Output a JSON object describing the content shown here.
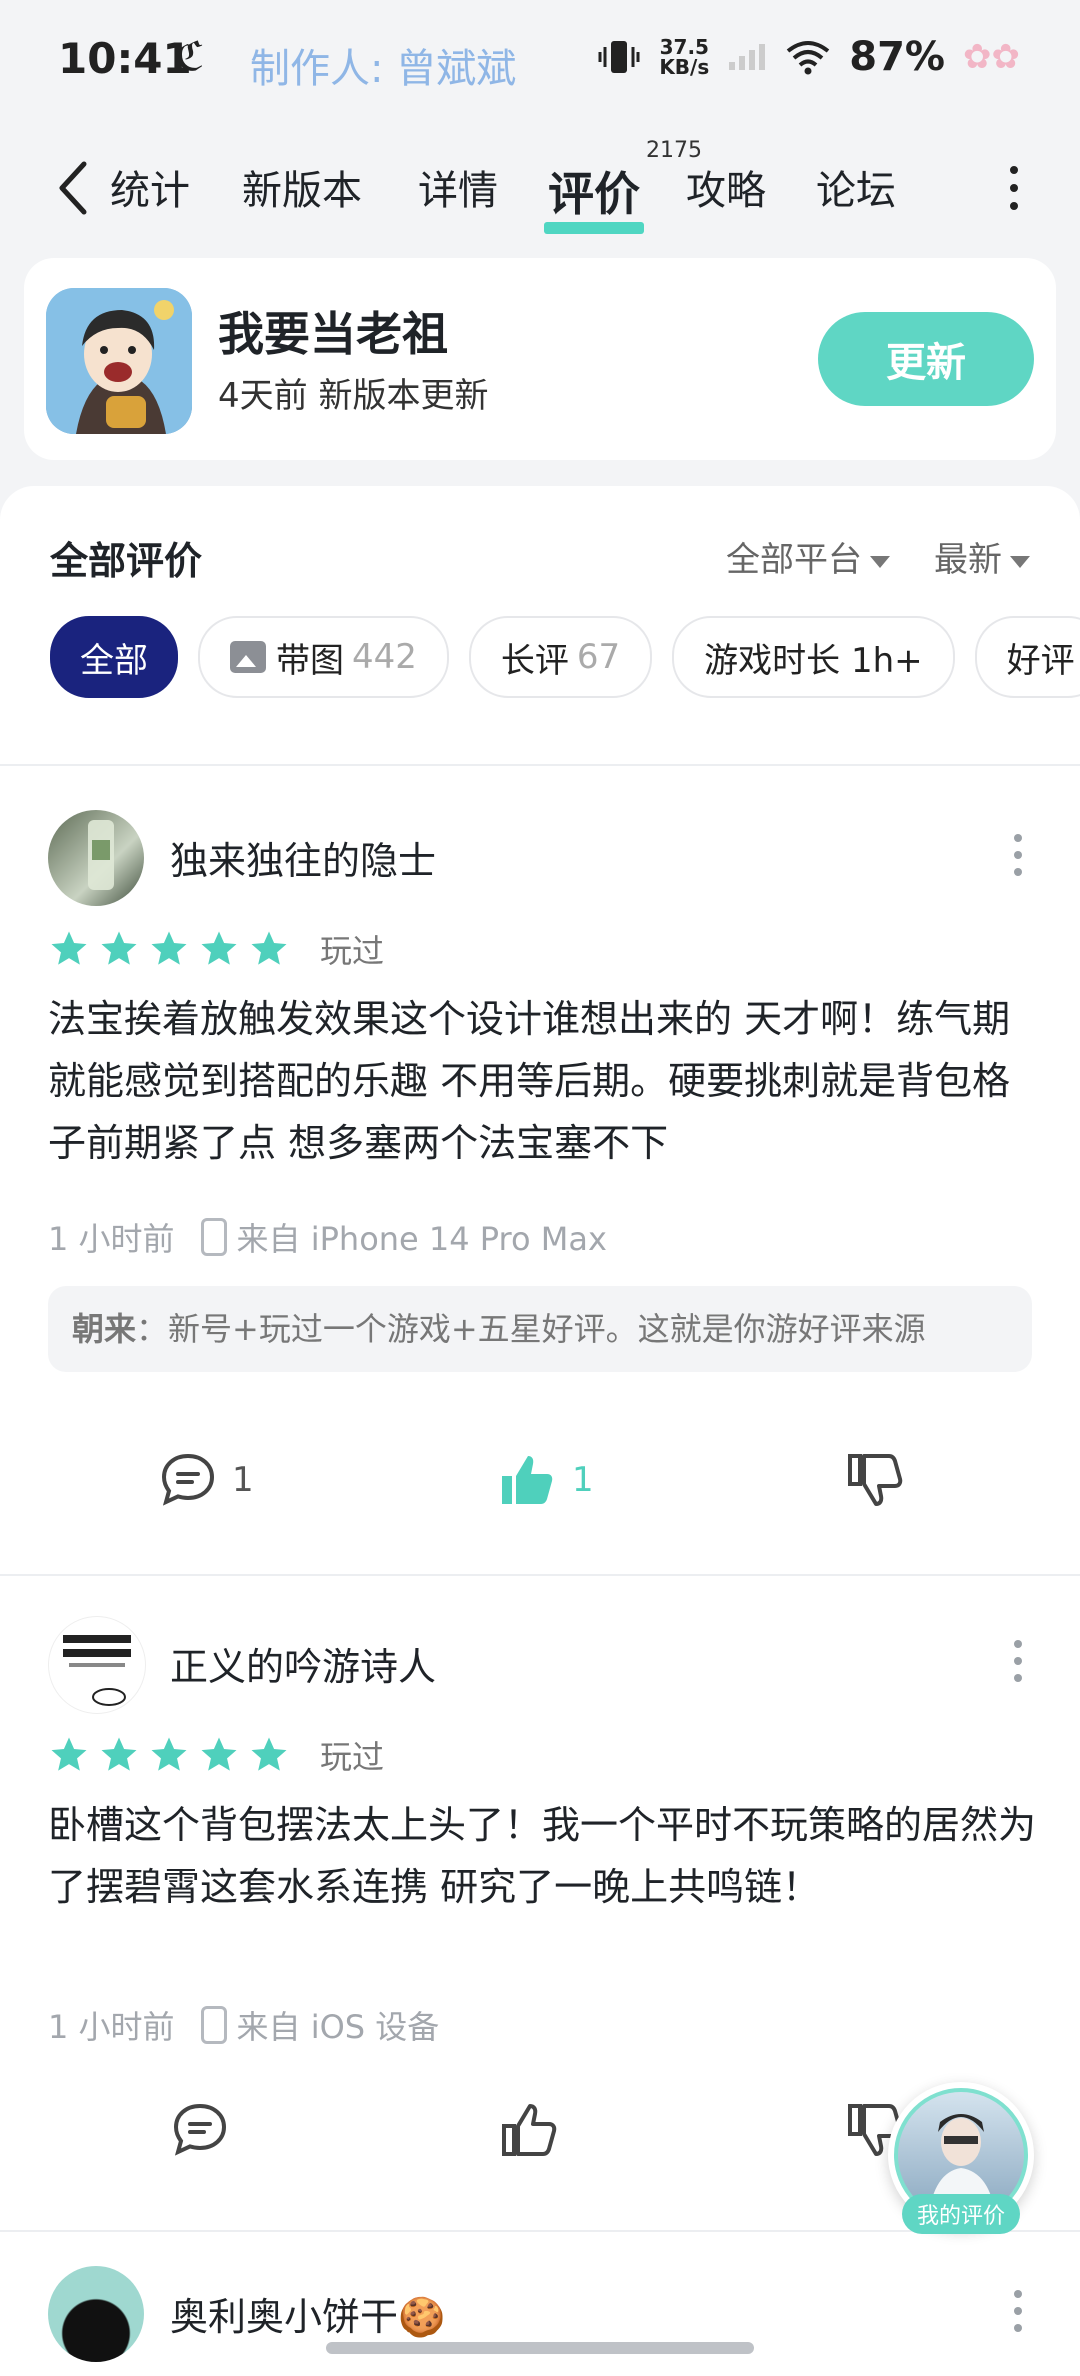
{
  "status_bar": {
    "time": "10:41",
    "carrier_glyph": "ℭ",
    "maker": "制作人: 曾斌斌",
    "net_speed_value": "37.5",
    "net_speed_unit": "KB/s",
    "battery": "87%"
  },
  "nav": {
    "tabs": [
      {
        "label": "统计",
        "active": false
      },
      {
        "label": "新版本",
        "active": false
      },
      {
        "label": "详情",
        "active": false
      },
      {
        "label": "评价",
        "active": true
      },
      {
        "label": "攻略",
        "active": false
      },
      {
        "label": "论坛",
        "active": false
      }
    ],
    "review_count_badge": "2175"
  },
  "app": {
    "name": "我要当老祖",
    "subtitle": "4天前 新版本更新",
    "update_label": "更新"
  },
  "reviews_header": {
    "title": "全部评价",
    "platform_filter": "全部平台",
    "sort_filter": "最新"
  },
  "chips": [
    {
      "label": "全部",
      "count": "",
      "active": true,
      "icon": ""
    },
    {
      "label": "带图",
      "count": "442",
      "active": false,
      "icon": "image-icon"
    },
    {
      "label": "长评",
      "count": "67",
      "active": false,
      "icon": ""
    },
    {
      "label": "游戏时长 1h+",
      "count": "",
      "active": false,
      "icon": ""
    },
    {
      "label": "好评",
      "count": "",
      "active": false,
      "icon": ""
    }
  ],
  "reviews": [
    {
      "user": "独来独往的隐士",
      "rating": 5,
      "played_label": "玩过",
      "content": "法宝挨着放触发效果这个设计谁想出来的 天才啊！练气期就能感觉到搭配的乐趣 不用等后期。硬要挑刺就是背包格子前期紧了点 想多塞两个法宝塞不下",
      "time": "1 小时前",
      "device": "来自 iPhone 14 Pro Max",
      "reply_author": "朝来",
      "reply_text": "：新号+玩过一个游戏+五星好评。这就是你游好评来源",
      "comment_count": "1",
      "like_count": "1"
    },
    {
      "user": "正义的吟游诗人",
      "rating": 5,
      "played_label": "玩过",
      "content": "卧槽这个背包摆法太上头了！我一个平时不玩策略的居然为了摆碧霄这套水系连携 研究了一晚上共鸣链！",
      "time": "1 小时前",
      "device": "来自 iOS 设备",
      "comment_count": "",
      "like_count": ""
    },
    {
      "user": "奥利奥小饼干🍪"
    }
  ],
  "fab": {
    "label": "我的评价"
  },
  "colors": {
    "accent": "#5fd6c4",
    "chip_active": "#1a237e",
    "star": "#4fd0bc"
  }
}
